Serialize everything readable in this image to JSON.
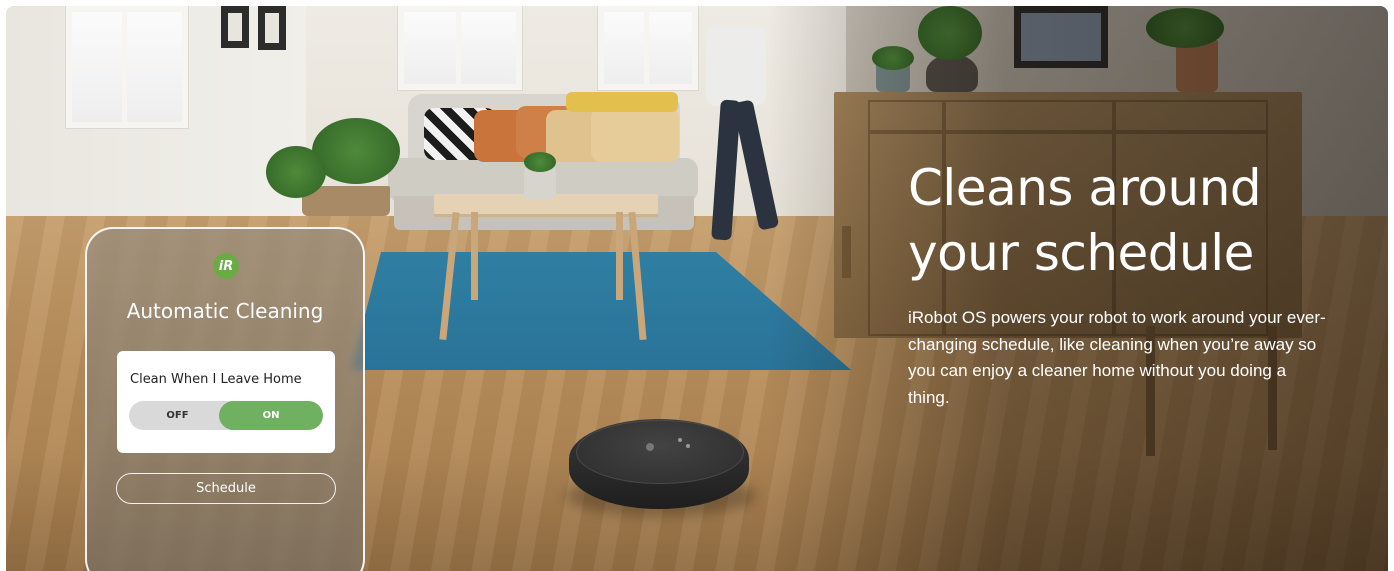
{
  "hero": {
    "headline": "Cleans around your schedule",
    "description": "iRobot OS powers your robot to work around your ever-changing schedule, like cleaning when you’re away so you can enjoy a cleaner home without you doing a thing."
  },
  "app_card": {
    "logo_letter": "iR",
    "title": "Automatic Cleaning",
    "setting_label": "Clean When I Leave Home",
    "toggle": {
      "off_label": "OFF",
      "on_label": "ON",
      "state": "on"
    },
    "schedule_button": "Schedule"
  },
  "colors": {
    "toggle_on": "#6fb160",
    "logo_green": "#6aab45",
    "rug_blue": "#2f7fa3"
  }
}
